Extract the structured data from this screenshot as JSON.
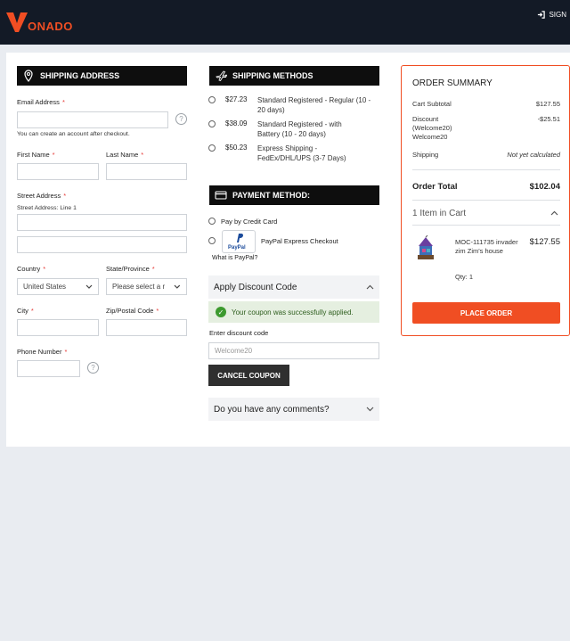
{
  "header": {
    "logo_text": "ONADO",
    "signin_label": "SIGN",
    "brand_color": "#f04e23"
  },
  "shipping_address": {
    "title": "SHIPPING ADDRESS",
    "email_label": "Email Address",
    "email_hint": "You can create an account after checkout.",
    "first_name_label": "First Name",
    "last_name_label": "Last Name",
    "street_label": "Street Address",
    "street_line1_label": "Street Address: Line 1",
    "country_label": "Country",
    "country_value": "United States",
    "state_label": "State/Province",
    "state_placeholder": "Please select a r",
    "city_label": "City",
    "zip_label": "Zip/Postal Code",
    "phone_label": "Phone Number",
    "required_mark": "*"
  },
  "shipping_methods": {
    "title": "SHIPPING METHODS",
    "options": [
      {
        "price": "$27.23",
        "name": "Standard Registered - Regular (10 - 20 days)"
      },
      {
        "price": "$38.09",
        "name": "Standard Registered - with Battery (10 - 20 days)"
      },
      {
        "price": "$50.23",
        "name": "Express Shipping - FedEx/DHL/UPS (3-7 Days)"
      }
    ]
  },
  "payment": {
    "title": "PAYMENT METHOD:",
    "credit_card_label": "Pay by Credit Card",
    "paypal_label": "PayPal Express Checkout",
    "paypal_logo_text": "PayPal",
    "paypal_link": "What is PayPal?"
  },
  "discount": {
    "title": "Apply Discount Code",
    "success_message": "Your coupon was successfully applied.",
    "code_label": "Enter discount code",
    "code_value": "Welcome20",
    "cancel_button": "CANCEL COUPON"
  },
  "comments": {
    "title": "Do you have any comments?"
  },
  "order_summary": {
    "title": "ORDER SUMMARY",
    "subtotal_label": "Cart Subtotal",
    "subtotal_value": "$127.55",
    "discount_label_line1": "Discount",
    "discount_label_line2": "(Welcome20)",
    "discount_label_line3": "Welcome20",
    "discount_value": "-$25.51",
    "shipping_label": "Shipping",
    "shipping_value": "Not yet calculated",
    "total_label": "Order Total",
    "total_value": "$102.04",
    "items_in_cart": "1 Item in Cart",
    "item": {
      "name_line1": "MOC-111735 invader",
      "name_line2": "zim Zim's house",
      "price": "$127.55",
      "qty": "Qty: 1"
    },
    "place_order": "PLACE ORDER"
  }
}
